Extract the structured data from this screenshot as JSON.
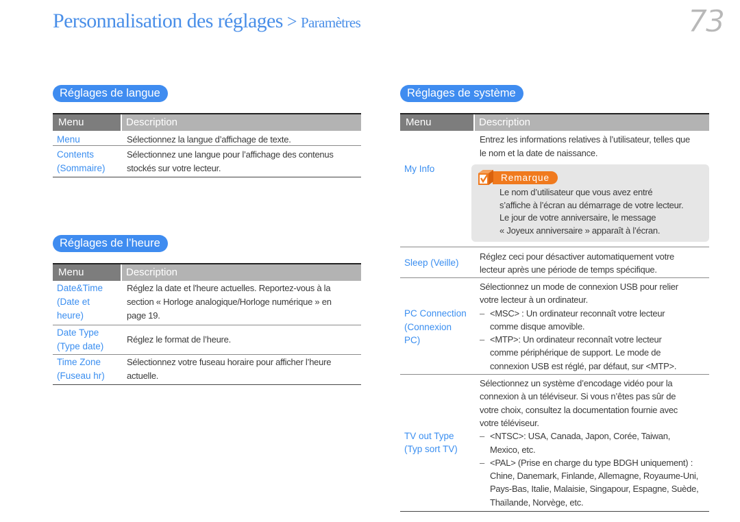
{
  "header": {
    "title": "Personnalisation des réglages",
    "separator": ">",
    "subtitle": "Paramètres",
    "page_number": "73"
  },
  "colors": {
    "accent_blue": "#3f8cf0",
    "title_blue": "#4a8fe8",
    "note_orange": "#f07a1e",
    "header_dark": "#7d7d7d",
    "header_light": "#b3b3b3"
  },
  "language": {
    "heading": "Réglages de langue",
    "columns": {
      "menu": "Menu",
      "description": "Description"
    },
    "rows": [
      {
        "menu": [
          "Menu"
        ],
        "desc": [
          "Sélectionnez la langue d’affichage de texte."
        ]
      },
      {
        "menu": [
          "Contents",
          "(Sommaire)"
        ],
        "desc": [
          "Sélectionnez une langue pour l’affichage des contenus",
          "stockés sur votre lecteur."
        ]
      }
    ]
  },
  "time": {
    "heading": "Réglages de l’heure",
    "columns": {
      "menu": "Menu",
      "description": "Description"
    },
    "rows": [
      {
        "menu": [
          "Date&Time",
          "(Date et",
          "heure)"
        ],
        "desc": [
          "Réglez la date et l'heure actuelles. Reportez-vous à la",
          "section « Horloge analogique/Horloge numérique » en",
          "page 19."
        ]
      },
      {
        "menu": [
          "Date Type",
          "(Type date)"
        ],
        "desc": [
          "Réglez le format de l’heure."
        ]
      },
      {
        "menu": [
          "Time Zone",
          "(Fuseau hr)"
        ],
        "desc": [
          "Sélectionnez votre fuseau horaire pour afficher l’heure",
          "actuelle."
        ]
      }
    ]
  },
  "system": {
    "heading": "Réglages de système",
    "columns": {
      "menu": "Menu",
      "description": "Description"
    },
    "rows": [
      {
        "menu": [
          "My Info"
        ],
        "desc": [
          "Entrez les informations relatives à l’utilisateur, telles que",
          "le nom et la date de naissance."
        ],
        "note": {
          "icon": "checkbox-icon",
          "label": "Remarque",
          "lines": [
            "Le nom d’utilisateur que vous avez entré",
            "s’affiche à l’écran au démarrage de votre lecteur.",
            "Le jour de votre anniversaire, le message",
            "« Joyeux anniversaire » apparaît à l’écran."
          ]
        }
      },
      {
        "menu": [
          "Sleep (Veille)"
        ],
        "desc": [
          "Réglez ceci pour désactiver automatiquement votre",
          "lecteur après une période de temps spécifique."
        ]
      },
      {
        "menu": [
          "PC Connection",
          "(Connexion",
          "PC)"
        ],
        "desc": [
          "Sélectionnez un mode de connexion USB pour relier",
          "votre lecteur à un ordinateur."
        ],
        "bullets": [
          {
            "dash": "–",
            "lines": [
              "<MSC> : Un ordinateur reconnaît votre lecteur",
              "comme disque amovible."
            ]
          },
          {
            "dash": "–",
            "lines": [
              "<MTP>: Un ordinateur reconnaît votre lecteur",
              "comme périphérique de support. Le mode de",
              "connexion USB est réglé, par défaut, sur <MTP>."
            ]
          }
        ]
      },
      {
        "menu": [
          "TV out Type",
          "(Typ sort TV)"
        ],
        "desc": [
          "Sélectionnez un système d’encodage vidéo pour la",
          "connexion à un téléviseur. Si vous n’êtes pas sûr de",
          "votre choix, consultez la documentation fournie avec",
          "votre téléviseur."
        ],
        "bullets": [
          {
            "dash": "–",
            "lines": [
              "<NTSC>: USA, Canada, Japon, Corée, Taiwan,",
              "Mexico, etc."
            ]
          },
          {
            "dash": "–",
            "lines": [
              "<PAL>  (Prise en charge du type BDGH uniquement) :",
              "Chine, Danemark, Finlande, Allemagne, Royaume-Uni,",
              "Pays-Bas, Italie, Malaisie, Singapour, Espagne, Suède,",
              "Thaïlande, Norvège, etc."
            ]
          }
        ]
      }
    ]
  }
}
